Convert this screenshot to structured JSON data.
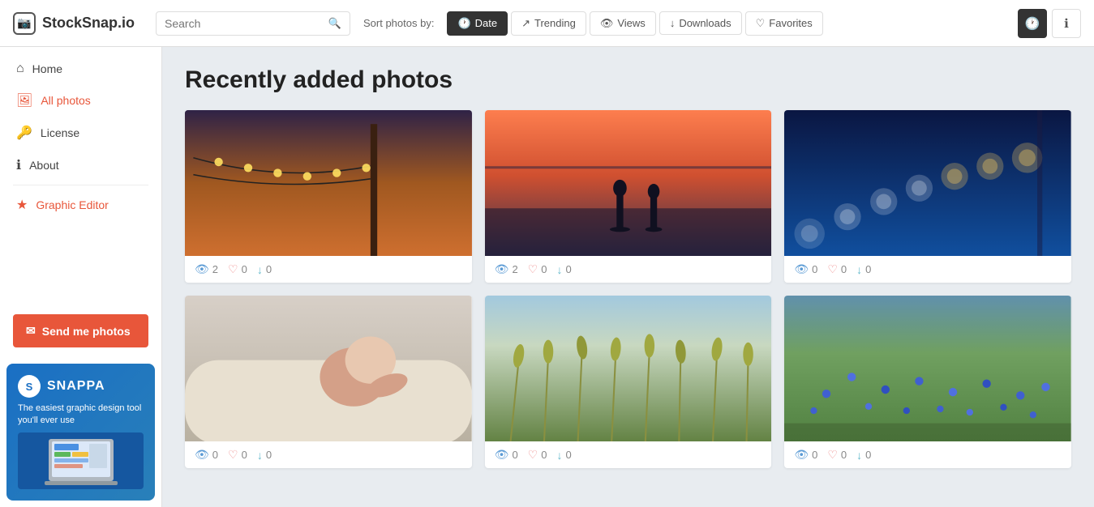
{
  "header": {
    "logo_text": "StockSnap.io",
    "search_placeholder": "Search",
    "sort_label": "Sort photos by:",
    "sort_options": [
      {
        "id": "date",
        "label": "Date",
        "active": true,
        "icon": "🕐"
      },
      {
        "id": "trending",
        "label": "Trending",
        "active": false,
        "icon": "↗"
      },
      {
        "id": "views",
        "label": "Views",
        "active": false,
        "icon": "👁"
      },
      {
        "id": "downloads",
        "label": "Downloads",
        "active": false,
        "icon": "↓"
      },
      {
        "id": "favorites",
        "label": "Favorites",
        "active": false,
        "icon": "♡"
      }
    ],
    "icon_buttons": [
      {
        "id": "settings",
        "icon": "🕐",
        "dark": true
      },
      {
        "id": "info",
        "icon": "ℹ",
        "dark": false
      }
    ]
  },
  "sidebar": {
    "nav_items": [
      {
        "id": "home",
        "label": "Home",
        "icon": "⌂",
        "active": false
      },
      {
        "id": "all-photos",
        "label": "All photos",
        "icon": "🖼",
        "active": true
      },
      {
        "id": "license",
        "label": "License",
        "icon": "🔑",
        "active": false
      },
      {
        "id": "about",
        "label": "About",
        "icon": "ℹ",
        "active": false
      },
      {
        "id": "graphic-editor",
        "label": "Graphic Editor",
        "icon": "★",
        "active": false
      }
    ],
    "send_btn_label": "✉ Send me photos",
    "ad": {
      "logo_letter": "S",
      "brand": "SNAPPA",
      "tagline": "The easiest graphic design tool you'll ever use"
    }
  },
  "main": {
    "page_title": "Recently added photos",
    "photos": [
      {
        "id": 1,
        "views": 2,
        "likes": 0,
        "downloads": 0,
        "gradient": "photo-1"
      },
      {
        "id": 2,
        "views": 2,
        "likes": 0,
        "downloads": 0,
        "gradient": "photo-2"
      },
      {
        "id": 3,
        "views": 0,
        "likes": 0,
        "downloads": 0,
        "gradient": "photo-3"
      },
      {
        "id": 4,
        "views": 0,
        "likes": 0,
        "downloads": 0,
        "gradient": "photo-4"
      },
      {
        "id": 5,
        "views": 0,
        "likes": 0,
        "downloads": 0,
        "gradient": "photo-5"
      },
      {
        "id": 6,
        "views": 0,
        "likes": 0,
        "downloads": 0,
        "gradient": "photo-6"
      }
    ]
  }
}
